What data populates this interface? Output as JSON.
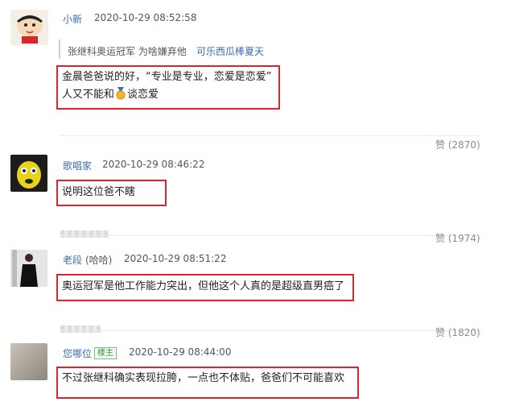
{
  "comments": [
    {
      "user": "小新",
      "time": "2020-10-29 08:52:58",
      "quote_text": "张继科奥运冠军 为啥嫌弃他",
      "quote_link": "可乐西瓜棒夏天",
      "text_line1": "金晨爸爸说的好，“专业是专业，恋爱是恋爱”",
      "text_line2_a": "人又不能和",
      "text_line2_b": "谈恋爱",
      "likes": "赞 (2870)"
    },
    {
      "user": "歌唱家",
      "time": "2020-10-29 08:46:22",
      "text": "说明这位爸不瞎",
      "likes": "赞 (1974)"
    },
    {
      "user": "老段",
      "user_suffix": "(哈哈)",
      "time": "2020-10-29 08:51:22",
      "text": "奥运冠军是他工作能力突出，但他这个人真的是超级直男癌了",
      "likes": "赞 (1820)"
    },
    {
      "user": "您哪位",
      "badge": "楼主",
      "time": "2020-10-29 08:44:00",
      "text": "不过张继科确实表现拉胯，一点也不体贴，爸爸们不可能喜欢"
    }
  ],
  "icons": {
    "medal": "gold-medal-icon"
  },
  "colors": {
    "username": "#3d6bb3",
    "highlight_border": "#d9252b",
    "badge": "#3a8f3a"
  }
}
